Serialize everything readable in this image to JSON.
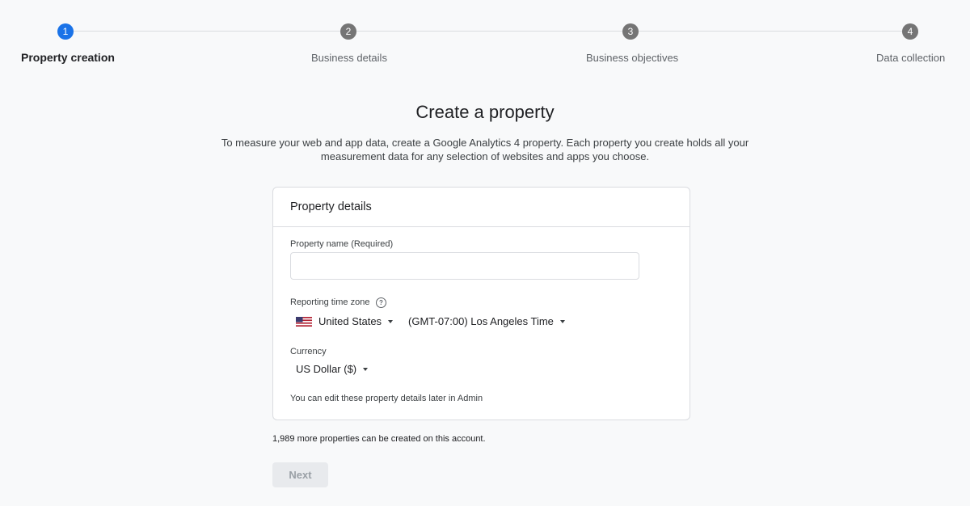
{
  "stepper": {
    "steps": [
      {
        "number": "1",
        "label": "Property creation"
      },
      {
        "number": "2",
        "label": "Business details"
      },
      {
        "number": "3",
        "label": "Business objectives"
      },
      {
        "number": "4",
        "label": "Data collection"
      }
    ],
    "active_step": 1
  },
  "page": {
    "title": "Create a property",
    "subtitle": "To measure your web and app data, create a Google Analytics 4 property. Each property you create holds all your measurement data for any selection of websites and apps you choose."
  },
  "card": {
    "header": "Property details",
    "property_name_label": "Property name (Required)",
    "property_name_value": "",
    "time_zone_label": "Reporting time zone",
    "help_icon": "?",
    "country": "United States",
    "time_zone": "(GMT-07:00) Los Angeles Time",
    "currency_label": "Currency",
    "currency": "US Dollar ($)",
    "note": "You can edit these property details later in Admin"
  },
  "footer": {
    "count_text": "1,989 more properties can be created on this account.",
    "next_label": "Next"
  },
  "colors": {
    "accent": "#1a73e8",
    "step_inactive": "#757575",
    "background": "#f8f9fa"
  }
}
